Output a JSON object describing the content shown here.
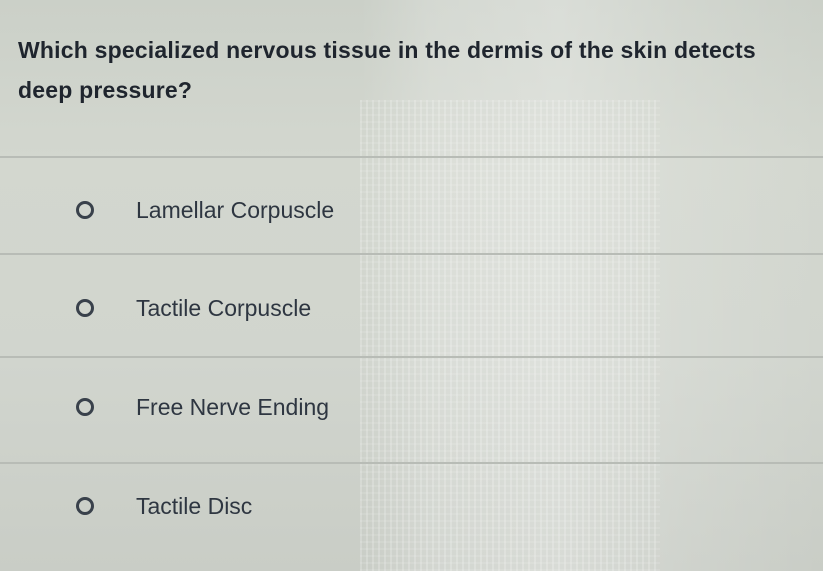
{
  "question": {
    "text": "Which specialized nervous tissue in the dermis of the skin detects deep pressure?"
  },
  "options": [
    {
      "label": "Lamellar Corpuscle",
      "selected": false
    },
    {
      "label": "Tactile Corpuscle",
      "selected": false
    },
    {
      "label": "Free Nerve Ending",
      "selected": false
    },
    {
      "label": "Tactile Disc",
      "selected": false
    }
  ],
  "colors": {
    "background": "#cfd3cc",
    "text": "#1f252e",
    "radio": "#39414b",
    "divider": "#b8bcb6"
  }
}
